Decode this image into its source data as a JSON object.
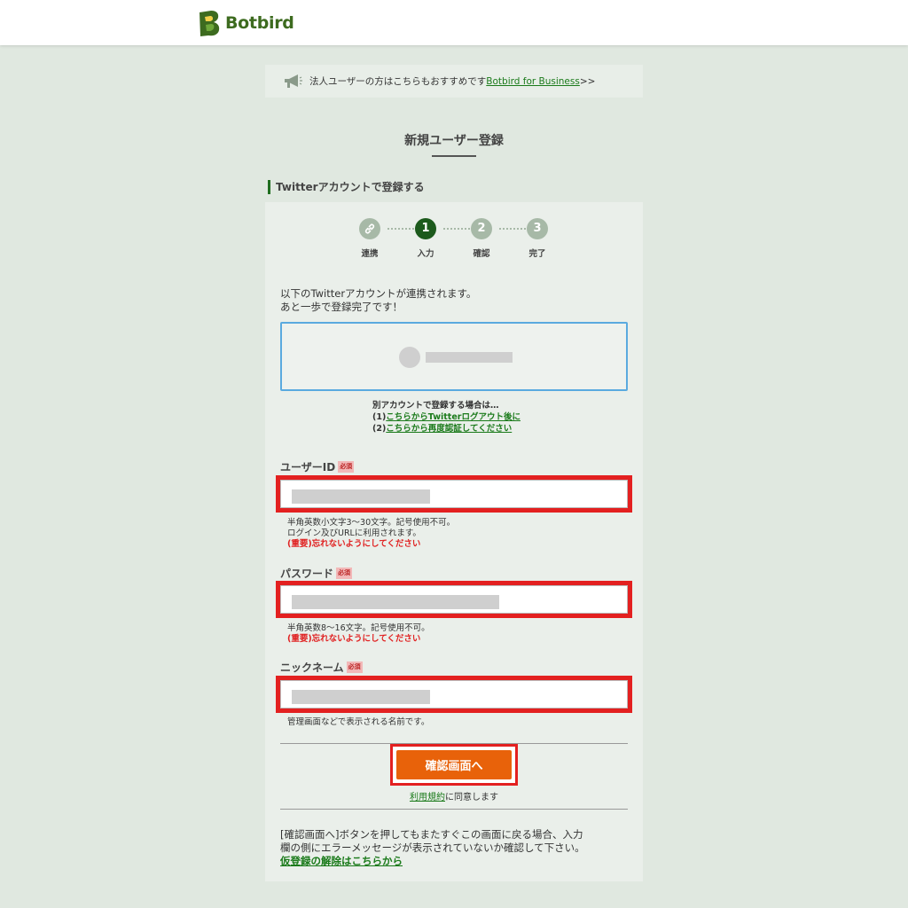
{
  "header": {
    "brand": "Botbird"
  },
  "notice": {
    "text": "法人ユーザーの方はこちらもおすすめです",
    "link": "Botbird for Business",
    "suffix": ">>"
  },
  "page_title": "新規ユーザー登録",
  "section_heading": "Twitterアカウントで登録する",
  "steps": [
    {
      "number": "",
      "label": "連携",
      "icon": "link-icon",
      "state": "done"
    },
    {
      "number": "1",
      "label": "入力",
      "state": "active"
    },
    {
      "number": "2",
      "label": "確認",
      "state": "pending"
    },
    {
      "number": "3",
      "label": "完了",
      "state": "pending"
    }
  ],
  "intro": {
    "line1": "以下のTwitterアカウントが連携されます。",
    "line2": "あと一歩で登録完了です！"
  },
  "alt_account": {
    "heading": "別アカウントで登録する場合は…",
    "item1_prefix": "(1)",
    "item1_link": "こちらからTwitterログアウト後に",
    "item2_prefix": "(2)",
    "item2_link": "こちらから再度認証してください"
  },
  "fields": {
    "user_id": {
      "label": "ユーザーID",
      "required": "必須",
      "hint1": "半角英数小文字3〜30文字。記号使用不可。",
      "hint2": "ログイン及びURLに利用されます。",
      "warning": "(重要)忘れないようにしてください"
    },
    "password": {
      "label": "パスワード",
      "required": "必須",
      "hint1": "半角英数8〜16文字。記号使用不可。",
      "warning": "(重要)忘れないようにしてください"
    },
    "nickname": {
      "label": "ニックネーム",
      "required": "必須",
      "hint1": "管理画面などで表示される名前です。"
    }
  },
  "submit_label": "確認画面へ",
  "terms": {
    "link": "利用規約",
    "suffix": "に同意します"
  },
  "footer": {
    "line1": "[確認画面へ]ボタンを押してもまたすぐこの画面に戻る場合、入力",
    "line2": "欄の側にエラーメッセージが表示されていないか確認して下さい。",
    "link": "仮登録の解除はこちらから"
  },
  "colors": {
    "brand_green": "#3d6b1f",
    "accent_orange": "#e8620a",
    "highlight_red": "#e32020",
    "link_green": "#1a7a1a"
  }
}
